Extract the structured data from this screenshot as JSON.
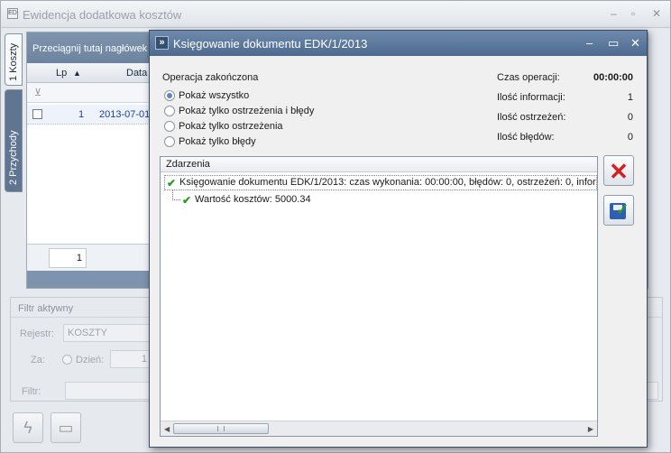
{
  "background": {
    "window_title": "Ewidencja dodatkowa kosztów",
    "tabs": [
      "1 Koszty",
      "2 Przychody"
    ],
    "group_bar_text": "Przeciągnij tutaj nagłówek k",
    "columns": {
      "lp": "Lp",
      "data": "Data"
    },
    "sort_indicator": "▲",
    "row": {
      "lp": "1",
      "data": "2013-07-01"
    },
    "footer_count": "1",
    "filter": {
      "title": "Filtr aktywny",
      "rejestr_label": "Rejestr:",
      "rejestr_value": "KOSZTY",
      "za_label": "Za:",
      "dzien_label": "Dzień:",
      "dzien_value": "1",
      "filtr_label": "Filtr:"
    }
  },
  "dialog": {
    "title": "Księgowanie dokumentu EDK/1/2013",
    "status": "Operacja zakończona",
    "options": [
      {
        "label": "Pokaż wszystko",
        "checked": true
      },
      {
        "label": "Pokaż tylko ostrzeżenia i błędy",
        "checked": false
      },
      {
        "label": "Pokaż tylko ostrzeżenia",
        "checked": false
      },
      {
        "label": "Pokaż tylko błędy",
        "checked": false
      }
    ],
    "stats": [
      {
        "label": "Czas operacji:",
        "value": "00:00:00"
      },
      {
        "label": "Ilość informacji:",
        "value": "1"
      },
      {
        "label": "Ilość ostrzeżeń:",
        "value": "0"
      },
      {
        "label": "Ilość błędów:",
        "value": "0"
      }
    ],
    "events_header": "Zdarzenia",
    "events": [
      "Księgowanie dokumentu EDK/1/2013: czas wykonania: 00:00:00, błędów: 0, ostrzeżeń: 0, inform",
      "Wartość kosztów: 5000.34"
    ]
  },
  "icons": {
    "minimize": "minimize-icon",
    "maximize": "maximize-icon",
    "close": "close-icon"
  },
  "colors": {
    "dialog_titlebar": "#5a7698",
    "close_red": "#d21f1f",
    "check_green": "#2f9a1f"
  }
}
